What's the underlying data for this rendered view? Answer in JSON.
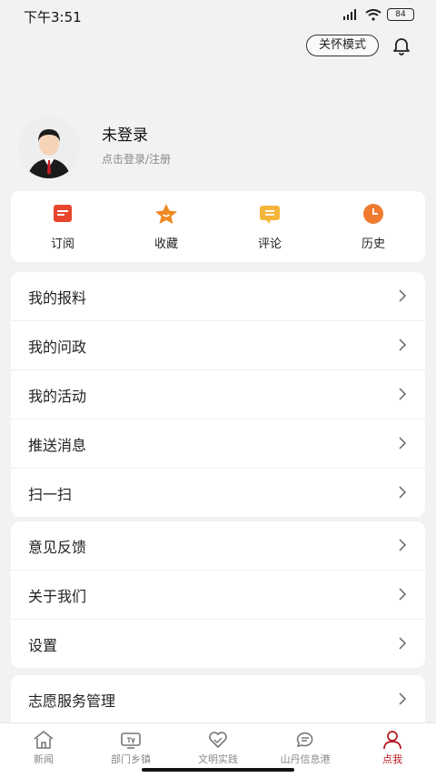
{
  "status": {
    "time": "下午3:51",
    "battery": "84"
  },
  "header": {
    "care_mode": "关怀模式"
  },
  "profile": {
    "name": "未登录",
    "sub": "点击登录/注册"
  },
  "quick": [
    {
      "label": "订阅",
      "icon": "subscribe-icon",
      "color": "#e8452f"
    },
    {
      "label": "收藏",
      "icon": "star-icon",
      "color": "#f08a24"
    },
    {
      "label": "评论",
      "icon": "comment-icon",
      "color": "#f5b53a"
    },
    {
      "label": "历史",
      "icon": "clock-icon",
      "color": "#f07a2e"
    }
  ],
  "menu1": [
    "我的报料",
    "我的问政",
    "我的活动",
    "推送消息",
    "扫一扫"
  ],
  "menu2": [
    "意见反馈",
    "关于我们",
    "设置"
  ],
  "menu3": [
    "志愿服务管理"
  ],
  "nav": [
    {
      "label": "新闻",
      "icon": "home-icon"
    },
    {
      "label": "部门乡镇",
      "icon": "tv-icon"
    },
    {
      "label": "文明实践",
      "icon": "heart-icon"
    },
    {
      "label": "山丹信息港",
      "icon": "chat-icon"
    },
    {
      "label": "点我",
      "icon": "user-icon"
    }
  ],
  "colors": {
    "accent": "#b8151f"
  }
}
